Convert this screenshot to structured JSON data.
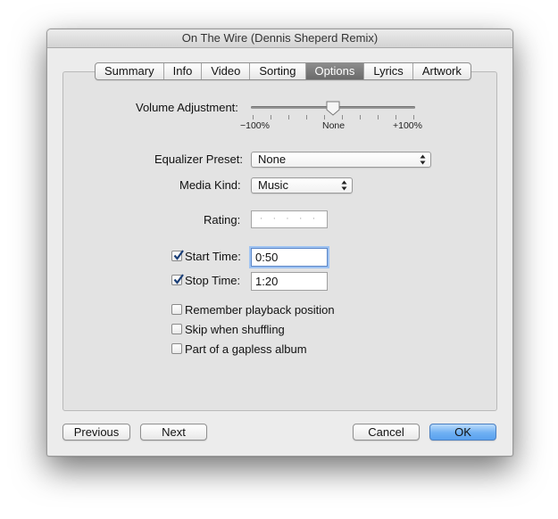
{
  "window": {
    "title": "On The Wire (Dennis Sheperd Remix)"
  },
  "tabs": [
    {
      "label": "Summary"
    },
    {
      "label": "Info"
    },
    {
      "label": "Video"
    },
    {
      "label": "Sorting"
    },
    {
      "label": "Options",
      "active": true
    },
    {
      "label": "Lyrics"
    },
    {
      "label": "Artwork"
    }
  ],
  "volume": {
    "label": "Volume Adjustment:",
    "min_label": "−100%",
    "mid_label": "None",
    "max_label": "+100%",
    "value_percent": 0
  },
  "equalizer": {
    "label": "Equalizer Preset:",
    "value": "None"
  },
  "media_kind": {
    "label": "Media Kind:",
    "value": "Music"
  },
  "rating": {
    "label": "Rating:",
    "value": "· · · · ·"
  },
  "start_time": {
    "label": "Start Time:",
    "value": "0:50",
    "checked": true
  },
  "stop_time": {
    "label": "Stop Time:",
    "value": "1:20",
    "checked": true
  },
  "options": [
    {
      "label": "Remember playback position",
      "checked": false
    },
    {
      "label": "Skip when shuffling",
      "checked": false
    },
    {
      "label": "Part of a gapless album",
      "checked": false
    }
  ],
  "buttons": {
    "previous": "Previous",
    "next": "Next",
    "cancel": "Cancel",
    "ok": "OK"
  },
  "colors": {
    "active_tab": "#7b7b7b",
    "default_button": "#6fb0f3",
    "focus_ring": "#9fc3f2"
  }
}
